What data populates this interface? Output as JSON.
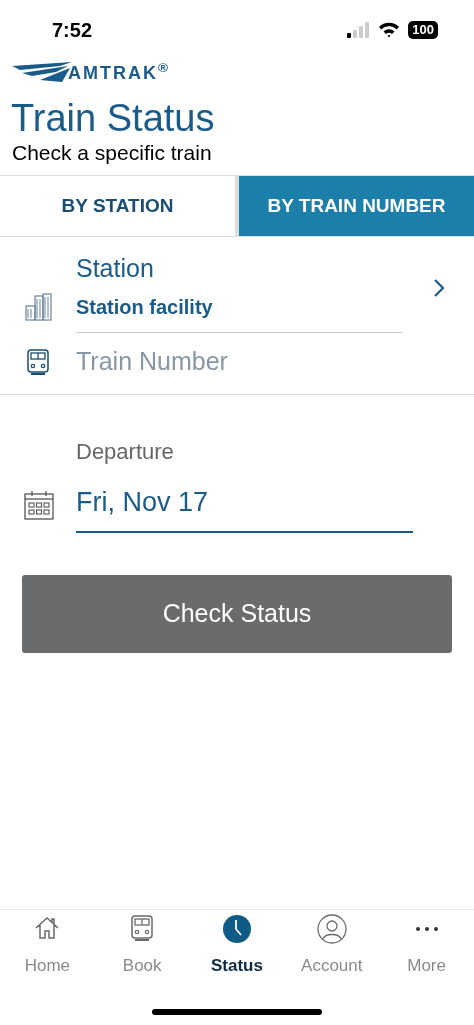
{
  "status_bar": {
    "time": "7:52",
    "battery": "100"
  },
  "logo": {
    "text": "AMTRAK$^{®}$"
  },
  "header": {
    "title": "Train Status",
    "subtitle": "Check a specific train"
  },
  "tabs": [
    {
      "label": "BY STATION",
      "selected": false
    },
    {
      "label": "BY TRAIN NUMBER",
      "selected": true
    }
  ],
  "station": {
    "label": "Station",
    "value": "Station facility"
  },
  "train_number": {
    "placeholder": "Train Number"
  },
  "departure": {
    "label": "Departure",
    "value": "Fri, Nov 17"
  },
  "check_button": "Check Status",
  "nav": [
    {
      "label": "Home",
      "kind": "home",
      "selected": false
    },
    {
      "label": "Book",
      "kind": "train",
      "selected": false
    },
    {
      "label": "Status",
      "kind": "clock",
      "selected": true
    },
    {
      "label": "Account",
      "kind": "person",
      "selected": false
    },
    {
      "label": "More",
      "kind": "dots",
      "selected": false
    }
  ]
}
